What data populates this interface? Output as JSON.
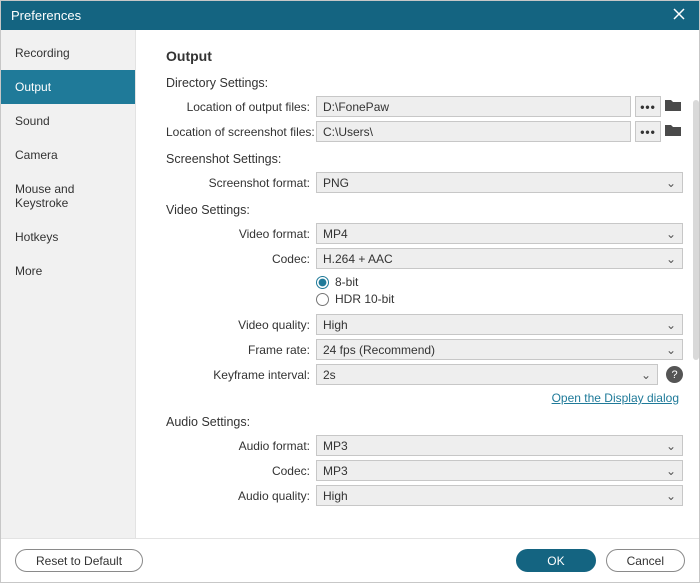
{
  "window": {
    "title": "Preferences"
  },
  "sidebar": {
    "items": [
      {
        "label": "Recording"
      },
      {
        "label": "Output",
        "active": true
      },
      {
        "label": "Sound"
      },
      {
        "label": "Camera"
      },
      {
        "label": "Mouse and Keystroke"
      },
      {
        "label": "Hotkeys"
      },
      {
        "label": "More"
      }
    ]
  },
  "main": {
    "title": "Output",
    "directory": {
      "heading": "Directory Settings:",
      "output_label": "Location of output files:",
      "output_value": "D:\\FonePaw",
      "screenshot_label": "Location of screenshot files:",
      "screenshot_value": "C:\\Users\\"
    },
    "screenshot": {
      "heading": "Screenshot Settings:",
      "format_label": "Screenshot format:",
      "format_value": "PNG"
    },
    "video": {
      "heading": "Video Settings:",
      "format_label": "Video format:",
      "format_value": "MP4",
      "codec_label": "Codec:",
      "codec_value": "H.264 + AAC",
      "bitdepth": {
        "opt1": "8-bit",
        "opt2": "HDR 10-bit"
      },
      "quality_label": "Video quality:",
      "quality_value": "High",
      "framerate_label": "Frame rate:",
      "framerate_value": "24 fps (Recommend)",
      "keyframe_label": "Keyframe interval:",
      "keyframe_value": "2s",
      "display_link": "Open the Display dialog"
    },
    "audio": {
      "heading": "Audio Settings:",
      "format_label": "Audio format:",
      "format_value": "MP3",
      "codec_label": "Codec:",
      "codec_value": "MP3",
      "quality_label": "Audio quality:",
      "quality_value": "High"
    }
  },
  "footer": {
    "reset": "Reset to Default",
    "ok": "OK",
    "cancel": "Cancel"
  },
  "glyphs": {
    "dots": "•••",
    "chev": "⌄",
    "help": "?"
  }
}
